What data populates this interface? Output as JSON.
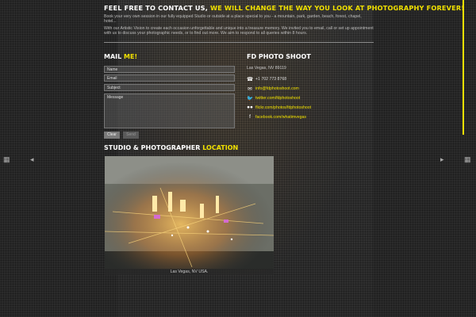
{
  "header": {
    "title_white": "FEEL FREE TO CONTACT US,",
    "title_yellow": "WE WILL CHANGE THE WAY YOU LOOK AT PHOTOGRAPHY FOREVER!"
  },
  "intro": {
    "p1": "Book your very own session in our fully equipped Studio or outside at a place special to you - a mountain, park, garden, beach, forest, chapel, hotel...",
    "p2": "With our Artistic Vision to create each occasion unforgettable and unique into a treasure memory. We invited you to email, call or set up appointment with us to discuss your photographic needs, or to find out more. We aim to respond to all queries within 8 hours."
  },
  "mail": {
    "heading_white": "MAIL",
    "heading_yellow": "ME!",
    "name_placeholder": "Name",
    "email_placeholder": "Email",
    "subject_placeholder": "Subject",
    "message_placeholder": "Message",
    "clear_label": "Clear",
    "send_label": "Send"
  },
  "shoot": {
    "heading": "FD PHOTO SHOOT",
    "address": "Las Vegas, NV 89119",
    "contacts": [
      {
        "icon": "phone-icon",
        "glyph": "☎",
        "text": "+1 702 773 8768"
      },
      {
        "icon": "email-icon",
        "glyph": "✉",
        "text": "info@fdphotoshoot.com"
      },
      {
        "icon": "twitter-icon",
        "glyph": "🐦",
        "text": "twitter.com/fdphotoshoot"
      },
      {
        "icon": "flickr-icon",
        "glyph": "●●",
        "text": "flickr.com/photos/fdphotoshoot"
      },
      {
        "icon": "facebook-icon",
        "glyph": "f",
        "text": "facebook.com/whatimvegas"
      }
    ]
  },
  "location": {
    "heading_white": "STUDIO & PHOTOGRAPHER",
    "heading_yellow": "LOCATION",
    "caption": "Las Vegas, NV USA."
  },
  "colors": {
    "accent": "#f0e000",
    "background": "#2b2b2b"
  },
  "nav": {
    "grid_icon": "grid-icon",
    "prev_icon": "arrow-left-icon",
    "next_icon": "arrow-right-icon"
  }
}
